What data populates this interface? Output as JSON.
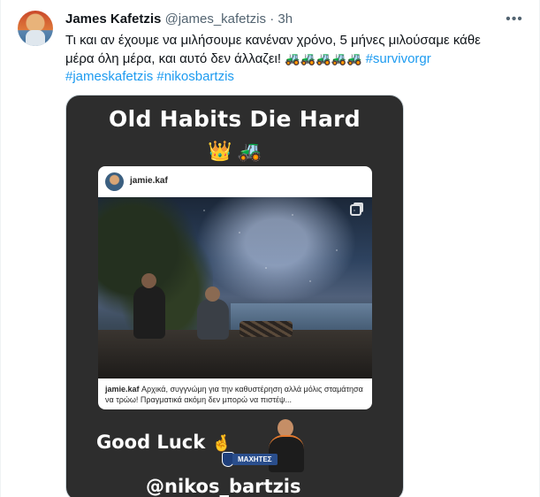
{
  "tweet": {
    "author_name": "James Kafetzis",
    "author_handle": "@james_kafetzis",
    "separator": "·",
    "time": "3h",
    "more_icon": "more-horizontal-icon",
    "text_line1": "Τι και αν έχουμε να  μιλήσουμε  κανέναν χρόνο, 5 μήνες μιλούσαμε κάθε",
    "text_line2": "μέρα όλη μέρα, και αυτό δεν άλλαζει!",
    "tractors": "🚜🚜🚜🚜🚜",
    "hashtag1": "#survivorgr",
    "hashtag2": "#jameskafetzis",
    "hashtag3": "#nikosbartzis"
  },
  "media": {
    "title": "Old Habits Die Hard",
    "crown": "👑",
    "tractor": "🚜",
    "ig_user": "jamie.kaf",
    "ig_caption_user": "jamie.kaf",
    "ig_caption_text": " Αρχικά, συγγνώμη για την καθυστέρηση αλλά μόλις σταμάτησα να τρώω! Πραγματικά ακόμη δεν μπορώ να πιστέψ...",
    "good_luck": "Good Luck",
    "fingers_crossed": "🤞",
    "badge_text": "ΜΑΧΗΤΕΣ",
    "mention": "@nikos_bartzis"
  }
}
